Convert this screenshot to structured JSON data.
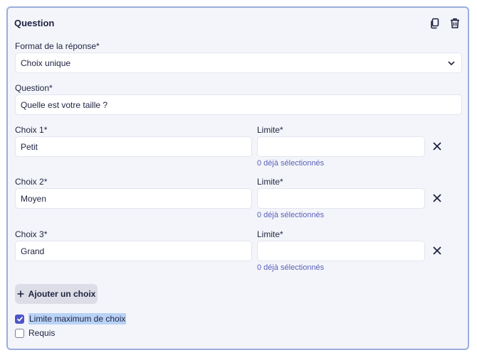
{
  "section": {
    "title": "Question",
    "icons": {
      "duplicate": "duplicate-icon",
      "delete": "trash-icon"
    }
  },
  "answer_format": {
    "label": "Format de la réponse*",
    "selected": "Choix unique"
  },
  "question": {
    "label": "Question*",
    "value": "Quelle est votre taille ?"
  },
  "choices": [
    {
      "label": "Choix 1*",
      "value": "Petit",
      "limit_label": "Limite*",
      "limit_value": "",
      "selected_count": "0 déjà sélectionnés"
    },
    {
      "label": "Choix 2*",
      "value": "Moyen",
      "limit_label": "Limite*",
      "limit_value": "",
      "selected_count": "0 déjà sélectionnés"
    },
    {
      "label": "Choix 3*",
      "value": "Grand",
      "limit_label": "Limite*",
      "limit_value": "",
      "selected_count": "0 déjà sélectionnés"
    }
  ],
  "add_choice_button": {
    "label": "Ajouter un choix"
  },
  "options": {
    "max_limit": {
      "label": "Limite maximum de choix",
      "checked": true
    },
    "required": {
      "label": "Requis",
      "checked": false
    }
  },
  "colors": {
    "accent": "#4f55c9",
    "border": "#9aaedb",
    "panel_bg": "#f4f5fa",
    "hint": "#5b61b8"
  }
}
